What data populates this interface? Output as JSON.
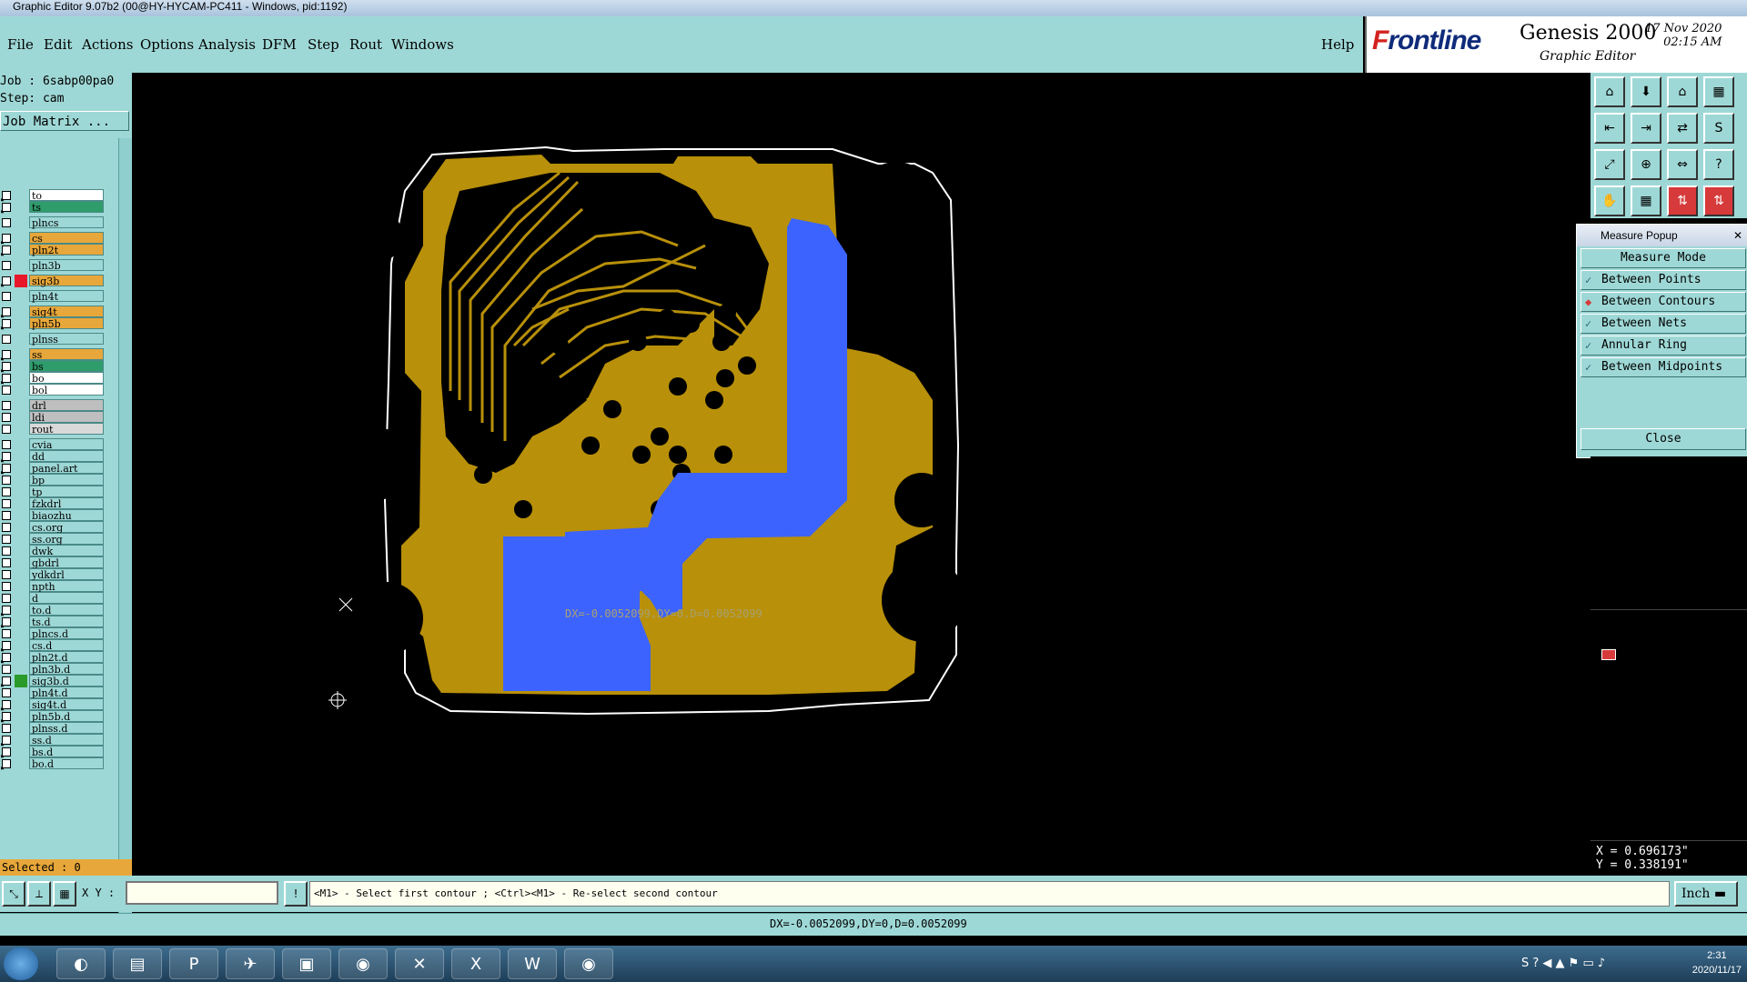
{
  "window": {
    "title": "Graphic Editor 9.07b2 (00@HY-HYCAM-PC411 - Windows, pid:1192)"
  },
  "menu": [
    "File",
    "Edit",
    "Actions",
    "Options",
    "Analysis",
    "DFM",
    "Step",
    "Rout",
    "Windows"
  ],
  "help": "Help",
  "brand": {
    "logo_a": "F",
    "logo_b": "rontline",
    "product": "Genesis 2000",
    "subtitle": "Graphic Editor",
    "date": "17 Nov 2020",
    "time": "02:15 AM"
  },
  "job": {
    "job_line": "Job : 6sabp00pa0",
    "step_line": "Step: cam",
    "matrix_button": "Job Matrix ..."
  },
  "layers": [
    {
      "name": "to",
      "color": "#ffffff",
      "arrow": true,
      "swatch": ""
    },
    {
      "name": "ts",
      "color": "#2f9c6c",
      "arrow": true,
      "swatch": ""
    },
    {
      "name": "plncs",
      "color": "#9ed8d6",
      "arrow": false,
      "swatch": ""
    },
    {
      "name": "cs",
      "color": "#e8a73a",
      "arrow": true,
      "swatch": ""
    },
    {
      "name": "pln2t",
      "color": "#e8a73a",
      "arrow": true,
      "swatch": ""
    },
    {
      "name": "pln3b",
      "color": "#9ed8d6",
      "arrow": false,
      "swatch": ""
    },
    {
      "name": "sig3b",
      "color": "#e8a73a",
      "arrow": true,
      "swatch": "#e8182a"
    },
    {
      "name": "pln4t",
      "color": "#9ed8d6",
      "arrow": false,
      "swatch": ""
    },
    {
      "name": "sig4t",
      "color": "#e8a73a",
      "arrow": true,
      "swatch": ""
    },
    {
      "name": "pln5b",
      "color": "#e8a73a",
      "arrow": true,
      "swatch": ""
    },
    {
      "name": "plnss",
      "color": "#9ed8d6",
      "arrow": false,
      "swatch": ""
    },
    {
      "name": "ss",
      "color": "#e8a73a",
      "arrow": true,
      "swatch": ""
    },
    {
      "name": "bs",
      "color": "#2f9c6c",
      "arrow": true,
      "swatch": ""
    },
    {
      "name": "bo",
      "color": "#ffffff",
      "arrow": true,
      "swatch": ""
    },
    {
      "name": "bol",
      "color": "#ffffff",
      "arrow": false,
      "swatch": ""
    },
    {
      "name": "drl",
      "color": "#bfbfbf",
      "arrow": false,
      "swatch": ""
    },
    {
      "name": "ldi",
      "color": "#bfbfbf",
      "arrow": false,
      "swatch": ""
    },
    {
      "name": "rout",
      "color": "#d9d9d9",
      "arrow": false,
      "swatch": ""
    },
    {
      "name": "cvia",
      "color": "#9ed8d6",
      "arrow": false,
      "swatch": ""
    },
    {
      "name": "dd",
      "color": "#9ed8d6",
      "arrow": true,
      "swatch": ""
    },
    {
      "name": "panel.art",
      "color": "#9ed8d6",
      "arrow": true,
      "swatch": ""
    },
    {
      "name": "bp",
      "color": "#9ed8d6",
      "arrow": false,
      "swatch": ""
    },
    {
      "name": "tp",
      "color": "#9ed8d6",
      "arrow": false,
      "swatch": ""
    },
    {
      "name": "fzkdrl",
      "color": "#9ed8d6",
      "arrow": false,
      "swatch": ""
    },
    {
      "name": "biaozhu",
      "color": "#9ed8d6",
      "arrow": false,
      "swatch": ""
    },
    {
      "name": "cs.org",
      "color": "#9ed8d6",
      "arrow": false,
      "swatch": ""
    },
    {
      "name": "ss.org",
      "color": "#9ed8d6",
      "arrow": false,
      "swatch": ""
    },
    {
      "name": "dwk",
      "color": "#9ed8d6",
      "arrow": false,
      "swatch": ""
    },
    {
      "name": "gbdrl",
      "color": "#9ed8d6",
      "arrow": false,
      "swatch": ""
    },
    {
      "name": "ydkdrl",
      "color": "#9ed8d6",
      "arrow": false,
      "swatch": ""
    },
    {
      "name": "npth",
      "color": "#9ed8d6",
      "arrow": false,
      "swatch": ""
    },
    {
      "name": "d",
      "color": "#9ed8d6",
      "arrow": false,
      "swatch": ""
    },
    {
      "name": "to.d",
      "color": "#9ed8d6",
      "arrow": true,
      "swatch": ""
    },
    {
      "name": "ts.d",
      "color": "#9ed8d6",
      "arrow": true,
      "swatch": ""
    },
    {
      "name": "plncs.d",
      "color": "#9ed8d6",
      "arrow": false,
      "swatch": ""
    },
    {
      "name": "cs.d",
      "color": "#9ed8d6",
      "arrow": true,
      "swatch": ""
    },
    {
      "name": "pln2t.d",
      "color": "#9ed8d6",
      "arrow": true,
      "swatch": ""
    },
    {
      "name": "pln3b.d",
      "color": "#9ed8d6",
      "arrow": false,
      "swatch": ""
    },
    {
      "name": "sig3b.d",
      "color": "#9ed8d6",
      "arrow": true,
      "swatch": "#2a9a2a"
    },
    {
      "name": "pln4t.d",
      "color": "#9ed8d6",
      "arrow": false,
      "swatch": ""
    },
    {
      "name": "sig4t.d",
      "color": "#9ed8d6",
      "arrow": true,
      "swatch": ""
    },
    {
      "name": "pln5b.d",
      "color": "#9ed8d6",
      "arrow": true,
      "swatch": ""
    },
    {
      "name": "plnss.d",
      "color": "#9ed8d6",
      "arrow": false,
      "swatch": ""
    },
    {
      "name": "ss.d",
      "color": "#9ed8d6",
      "arrow": true,
      "swatch": ""
    },
    {
      "name": "bs.d",
      "color": "#9ed8d6",
      "arrow": true,
      "swatch": ""
    },
    {
      "name": "bo.d",
      "color": "#9ed8d6",
      "arrow": true,
      "swatch": ""
    }
  ],
  "selected": "Selected : 0",
  "measure": {
    "title": "Measure Popup",
    "mode_label": "Measure Mode",
    "modes": [
      "Between Points",
      "Between Contours",
      "Between Nets",
      "Annular Ring",
      "Between Midpoints"
    ],
    "active_mode": "Between Contours",
    "close": "Close"
  },
  "measure_result": "DX=-0.0052099,DY=0,D=0.0052099",
  "coords": {
    "x": "X = 0.696173\"",
    "y": "Y = 0.338191\""
  },
  "xy_label": "X Y :",
  "xy_value": "",
  "prompt": "<M1> - Select first contour ; <Ctrl><M1> - Re-select second contour",
  "units": "Inch",
  "status": "DX=-0.0052099,DY=0,D=0.0052099",
  "taskbar": {
    "time": "2:31",
    "date": "2020/11/17"
  },
  "colors": {
    "background": "#000000",
    "copper": "#b8900a",
    "highlight": "#3d63ff",
    "panel": "#9ed8d6"
  }
}
